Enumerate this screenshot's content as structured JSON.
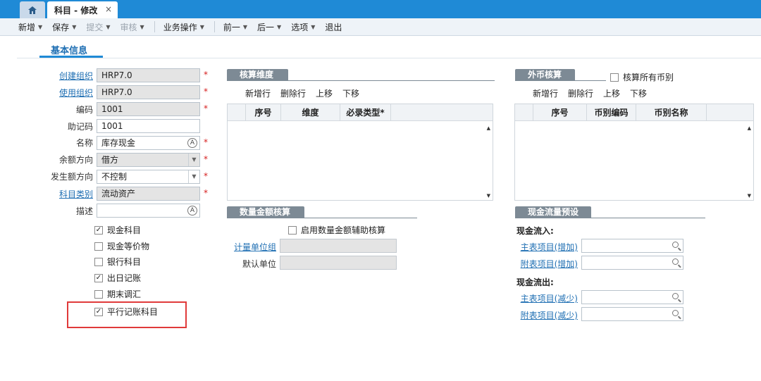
{
  "tabs": {
    "home_icon": "home-icon",
    "active_label": "科目 - 修改",
    "close": "×"
  },
  "toolbar": [
    {
      "label": "新增",
      "caret": true,
      "disabled": false
    },
    {
      "label": "保存",
      "caret": true,
      "disabled": false
    },
    {
      "label": "提交",
      "caret": true,
      "disabled": true
    },
    {
      "label": "审核",
      "caret": true,
      "disabled": true
    },
    {
      "label": "业务操作",
      "caret": true,
      "disabled": false
    },
    {
      "label": "前一",
      "caret": true,
      "disabled": false
    },
    {
      "label": "后一",
      "caret": true,
      "disabled": false
    },
    {
      "label": "选项",
      "caret": true,
      "disabled": false
    },
    {
      "label": "退出",
      "caret": false,
      "disabled": false
    }
  ],
  "section_title": "基本信息",
  "form": {
    "create_org_label": "创建组织",
    "create_org_value": "HRP7.0",
    "use_org_label": "使用组织",
    "use_org_value": "HRP7.0",
    "code_label": "编码",
    "code_value": "1001",
    "mnemonic_label": "助记码",
    "mnemonic_value": "1001",
    "name_label": "名称",
    "name_value": "库存现金",
    "balance_dir_label": "余额方向",
    "balance_dir_value": "借方",
    "amount_dir_label": "发生额方向",
    "amount_dir_value": "不控制",
    "category_label": "科目类别",
    "category_value": "流动资产",
    "desc_label": "描述",
    "desc_value": "",
    "required_mark": "*"
  },
  "checkboxes": [
    {
      "label": "现金科目",
      "checked": true
    },
    {
      "label": "现金等价物",
      "checked": false
    },
    {
      "label": "银行科目",
      "checked": false
    },
    {
      "label": "出日记账",
      "checked": true
    },
    {
      "label": "期末调汇",
      "checked": false
    },
    {
      "label": "平行记账科目",
      "checked": true
    }
  ],
  "check_mark": "✓",
  "accounting_dim": {
    "title": "核算维度",
    "tools": [
      "新增行",
      "删除行",
      "上移",
      "下移"
    ],
    "columns": [
      "序号",
      "维度",
      "必录类型*"
    ]
  },
  "foreign_currency": {
    "title": "外币核算",
    "all_currency_label": "核算所有币别",
    "tools": [
      "新增行",
      "删除行",
      "上移",
      "下移"
    ],
    "columns": [
      "序号",
      "币别编码",
      "币别名称"
    ]
  },
  "quantity": {
    "title": "数量金额核算",
    "enable_label": "启用数量金额辅助核算",
    "unit_group_label": "计量单位组",
    "default_unit_label": "默认单位"
  },
  "cashflow": {
    "title": "现金流量预设",
    "inflow_label": "现金流入:",
    "inflow_main_label": "主表项目(增加)",
    "inflow_sub_label": "附表项目(增加)",
    "outflow_label": "现金流出:",
    "outflow_main_label": "主表项目(减少)",
    "outflow_sub_label": "附表项目(减少)"
  },
  "icons": {
    "search": "search-icon",
    "lookup": "lookup-icon",
    "dropdown": "chevron-down-icon"
  },
  "colors": {
    "accent": "#1f8ad6",
    "highlight": "#e03a3a",
    "panel_header": "#7d8a95"
  }
}
